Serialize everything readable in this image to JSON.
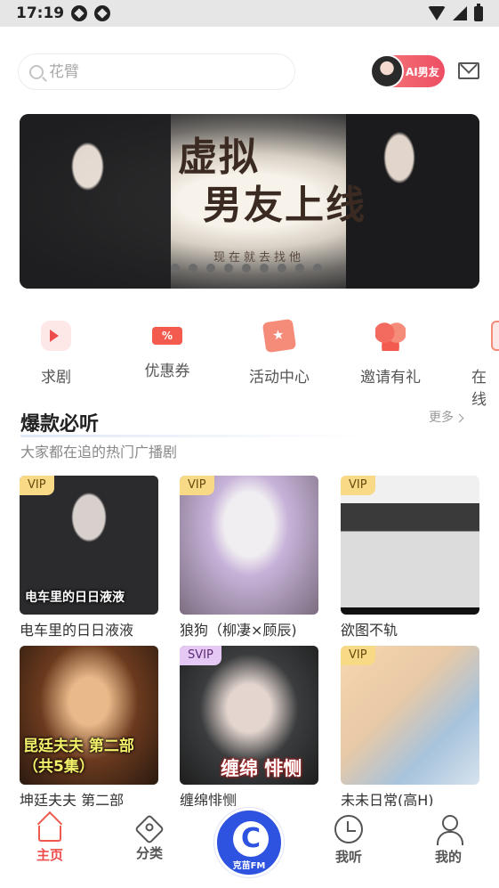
{
  "status_bar": {
    "time": "17:19"
  },
  "header": {
    "search_placeholder": "花臂",
    "ai_button_label": "AI男友"
  },
  "banner": {
    "title_line1": "虚拟",
    "title_line2": "男友上线",
    "subtitle": "现在就去找他",
    "page_count": 9
  },
  "quick_menu": [
    {
      "label": "求剧",
      "icon": "play-bubble-icon"
    },
    {
      "label": "优惠券",
      "icon": "coupon-icon",
      "icon_text": "%"
    },
    {
      "label": "活动中心",
      "icon": "star-ticket-icon"
    },
    {
      "label": "邀请有礼",
      "icon": "people-icon"
    },
    {
      "label": "在线",
      "icon": "online-icon"
    }
  ],
  "section": {
    "title": "爆款必听",
    "subtitle": "大家都在追的热门广播剧",
    "more_label": "更多"
  },
  "cards": [
    {
      "badge": "VIP",
      "title": "电车里的日日液液",
      "cover_text": "电车里的日日液液"
    },
    {
      "badge": "VIP",
      "title": "狼狗（柳凄×顾辰)",
      "cover_text": ""
    },
    {
      "badge": "VIP",
      "title": "欲图不轨",
      "cover_text": ""
    },
    {
      "badge": "",
      "title": "坤廷夫夫 第二部",
      "cover_text": "昆廷夫夫 第二部（共5集）"
    },
    {
      "badge": "SVIP",
      "title": "缠绵悱恻",
      "cover_text": "缠绵 悱恻"
    },
    {
      "badge": "VIP",
      "title": "未未日常(高H)",
      "cover_text": ""
    }
  ],
  "bottom_nav": {
    "home": "主页",
    "category": "分类",
    "center_text": "克苗FM",
    "listen": "我听",
    "mine": "我的"
  },
  "colors": {
    "accent_red": "#ee4d4d",
    "vip_badge": "#f7d986",
    "center_blue": "#2e53e0"
  }
}
